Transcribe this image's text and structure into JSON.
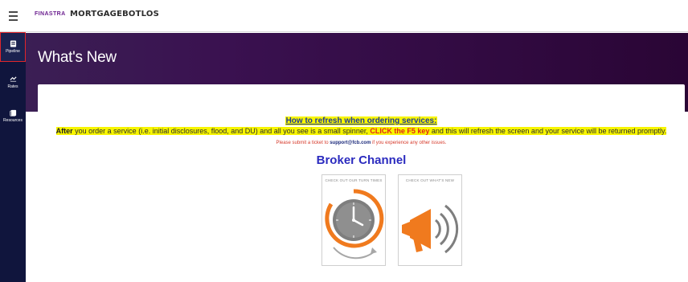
{
  "header": {
    "brand": "FINASTRA",
    "product": "MORTGAGEBOTLOS"
  },
  "sidebar": {
    "items": [
      {
        "label": "Pipeline",
        "icon": "pipeline-icon",
        "active": true
      },
      {
        "label": "Rates",
        "icon": "rates-icon"
      },
      {
        "label": "Resources",
        "icon": "resources-icon"
      }
    ]
  },
  "banner": {
    "title": "What's New"
  },
  "notice": {
    "title": "How to refresh when ordering services:",
    "line_bold_start": "After",
    "line_text_1": " you order a service (i.e. initial disclosures, flood, and DU) and all you see is a small spinner, ",
    "line_red": "CLICK the F5 key",
    "line_text_2": " and this will refresh the screen and your service will be returned promptly.",
    "support_text_1": "Please submit a ticket to ",
    "support_email": "support@fcb.com",
    "support_text_2": " if you experience any other issues."
  },
  "channel": {
    "title": "Broker Channel",
    "cards": [
      {
        "caption": "CHECK OUT OUR TURN TIMES",
        "icon": "clock-icon"
      },
      {
        "caption": "CHECK OUT WHAT'S NEW",
        "icon": "megaphone-icon"
      }
    ]
  },
  "colors": {
    "accent_orange": "#f07a1e",
    "sidebar_bg": "#10153d",
    "highlight": "#f7f500",
    "brand_purple": "#6b1f8f"
  }
}
